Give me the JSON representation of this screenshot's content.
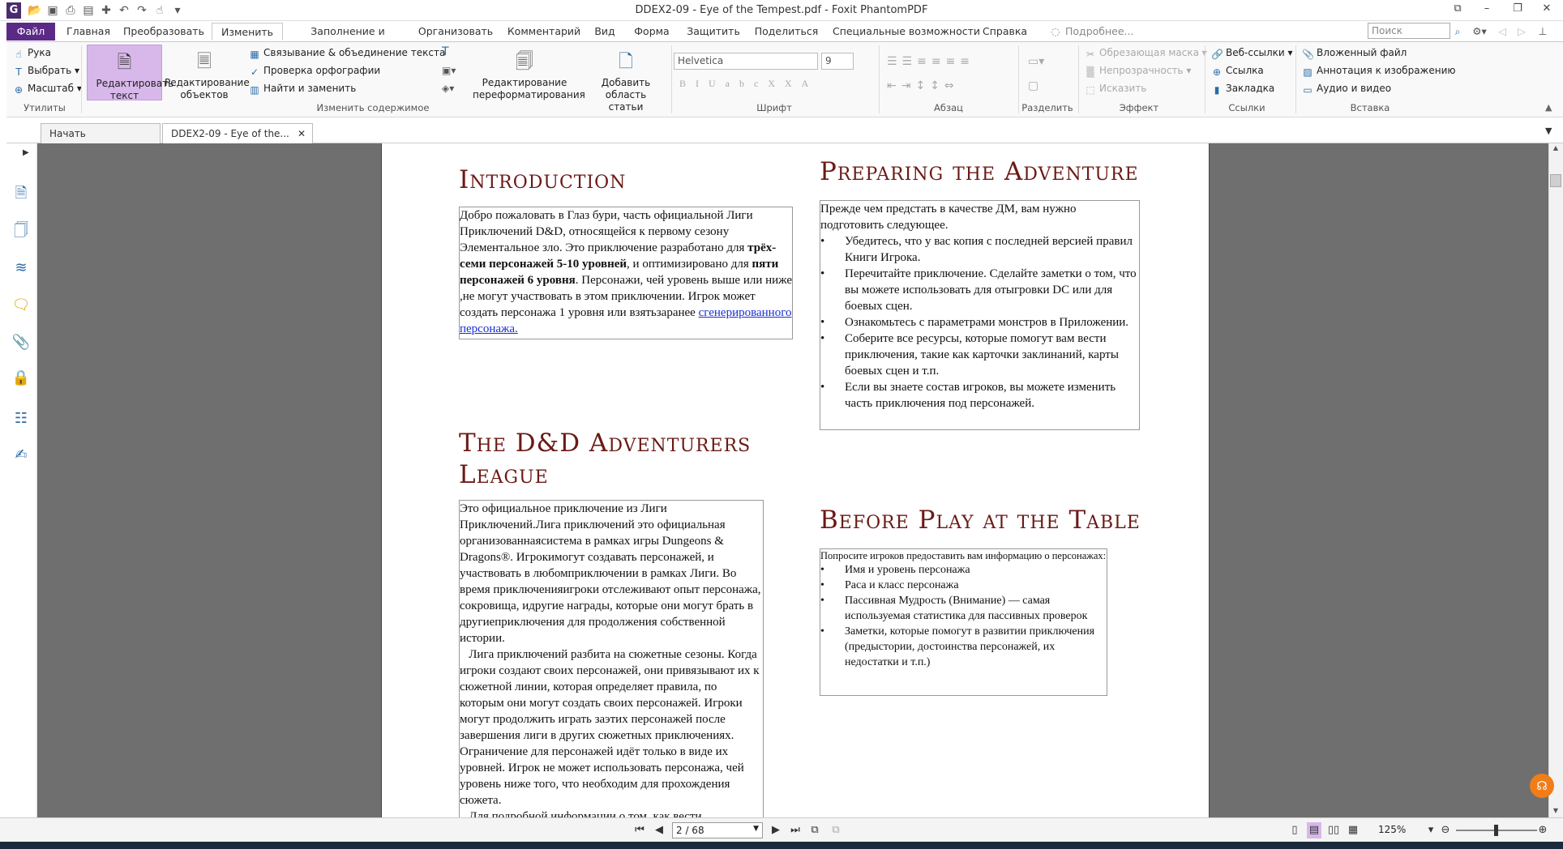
{
  "window": {
    "title": "DDEX2-09 - Eye of the Tempest.pdf - Foxit PhantomPDF",
    "logo": "G"
  },
  "menu": {
    "file": "Файл",
    "tabs": [
      "Главная",
      "Преобразовать",
      "Изменить",
      "Заполнение и подпись",
      "Организовать",
      "Комментарий",
      "Вид",
      "Форма",
      "Защитить",
      "Поделиться",
      "Специальные возможности",
      "Справка"
    ],
    "tell_me": "Подробнее...",
    "search_placeholder": "Поиск"
  },
  "ribbon": {
    "utilities": {
      "hand": "Рука",
      "select": "Выбрать",
      "zoom": "Масштаб",
      "group": "Утилиты"
    },
    "edit_text": "Редактировать текст",
    "edit_objects": "Редактирование объектов",
    "link_text": "Связывание & объединение текста",
    "spell": "Проверка орфографии",
    "find_replace": "Найти и заменить",
    "group_edit": "Изменить содержимое",
    "reflow": "Редактирование переформатирования",
    "add_area": "Добавить область статьи",
    "font_name": "Helvetica",
    "font_size": "9",
    "group_font": "Шрифт",
    "group_para": "Абзац",
    "group_split": "Разделить",
    "effect": {
      "clip_mask": "Обрезающая маска",
      "opacity": "Непрозрачность",
      "distort": "Исказить",
      "group": "Эффект"
    },
    "links": {
      "web": "Веб-ссылки",
      "link": "Ссылка",
      "bookmark": "Закладка",
      "group": "Ссылки"
    },
    "insert": {
      "file": "Вложенный файл",
      "image": "Аннотация к изображению",
      "media": "Аудио и видео",
      "group": "Вставка"
    }
  },
  "doc_tabs": {
    "start": "Начать",
    "current": "DDEX2-09 - Eye of the..."
  },
  "page": {
    "intro_title": "Introduction",
    "intro_parts": [
      " Добро пожаловать в Глаз бури, часть официальной Лиги Приключений D&D, относящейся к первому сезону Элементальное зло.  Это приключение разработано для ",
      "трёх-семи  персонажей 5-10  уровней",
      ", и оптимизировано для  ",
      "пяти персонажей 6  уровня",
      ".  Персонажи, чей уровень выше или ниже ,не  могут  участвовать в этом приключении.  Игрок может создать персонажа 1  уровня или взятьзаранее "
    ],
    "intro_link": "сгенерированного персонажа.",
    "league_title": "The D&D Adventurers League",
    "league_p1": "Это официальное приключение из Лиги Приключений.Лига приключений это официальная организованнаясистема в рамках игры Dungeons & Dragons®. Игрокимогут создавать персонажей, и участвовать в любомприключении в рамках Лиги. Во время приключенияигроки отслеживают опыт персонажа, сокровища, идругие награды, которые они могут брать в другиеприключения для продолжения собственной истории.",
    "league_p2": "   Лига приключений разбита на сюжетные сезоны. Когда игроки создают своих персонажей, они привязывают их к сюжетной линии, которая определяет правила, по которым они могут создать своих персонажей. Игроки могут продолжить играть заэтих персонажей после завершения лиги в других сюжетных приключениях. Ограничение для персонажей идёт только в виде их уровней. Игрок не может использовать персонажа, чей уровень ниже того, что необходим для прохождения сюжета.",
    "league_p3": "   Для подробной информации о том, как вести",
    "prep_title": "Preparing the Adventure",
    "prep_intro": "Прежде чем предстать в качестве ДМ, вам нужно подготовить следующее.",
    "prep_items": [
      "Убедитесь, что у вас копия с последней версией правил Книги Игрока.",
      "Перечитайте приключение. Сделайте заметки о том, что вы можете использовать для отыгровки DC или для боевых сцен.",
      "Ознакомьтесь с параметрами монстров в Приложении.",
      "Соберите все ресурсы, которые помогут вам вести приключения, такие как карточки заклинаний, карты боевых сцен и т.п.",
      "Если вы знаете состав игроков, вы можете изменить часть приключения под персонажей."
    ],
    "before_title": "Before Play at the Table",
    "before_intro": "Попросите игроков предоставить вам информацию о персонажах:",
    "before_items": [
      "Имя и уровень персонажа",
      "Раса и класс персонажа",
      "Пассивная Мудрость (Внимание) — самая используемая статистика для пассивных проверок",
      "Заметки, которые помогут в развитии приключения (предыстории, достоинства персонажей, их недостатки и т.п.)"
    ]
  },
  "status": {
    "page": "2 / 68",
    "zoom": "125%"
  },
  "colors": {
    "accent": "#5b2a86",
    "heading": "#6b1a16",
    "link": "#1a2fd3"
  }
}
